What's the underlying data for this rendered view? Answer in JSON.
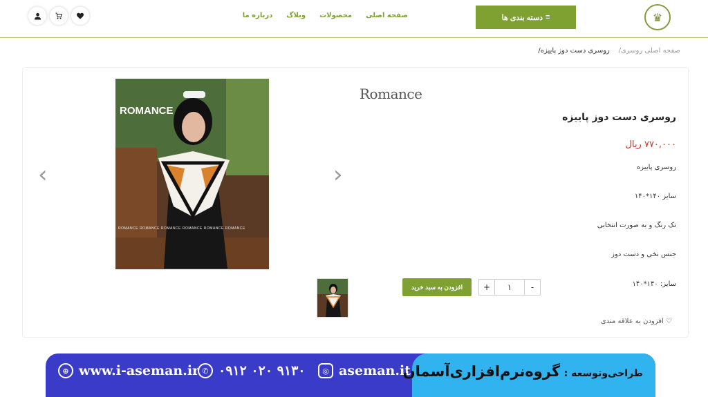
{
  "header": {
    "logo_glyph": "♛",
    "category_button": "دسته بندی ها",
    "nav": [
      "صفحه اصلی",
      "محصولات",
      "وبلاگ",
      "درباره ما"
    ],
    "icons": [
      "heart-icon",
      "cart-icon",
      "user-icon"
    ]
  },
  "breadcrumb": {
    "home": "صفحه اصلی",
    "parent": "روسری/",
    "current": "روسری دست دوز پاییزه/"
  },
  "product": {
    "brand": "Romance",
    "image_brand": "ROMANCE",
    "image_strip": "ROMANCE  ROMANCE  ROMANCE  ROMANCE  ROMANCE  ROMANCE",
    "title": "روسری دست دوز پاییزه",
    "price": "۷۷۰,۰۰۰ ریال",
    "desc1": "روسری پاییزه",
    "desc2": "سایز ۱۴۰*۱۴۰",
    "desc3": "تک رنگ و به صورت انتخابی",
    "desc4": "جنس نخی و دست دوز",
    "size_label": "سایز: ۱۴۰*۱۴۰",
    "quantity": "۱",
    "add_to_cart": "افزودن به سبد خرید",
    "wishlist": "افزودن به علاقه مندی"
  },
  "banner": {
    "website": "www.i-aseman.ir",
    "phone": "۰۹۱۲ ۰۲۰ ۹۱۳۰",
    "instagram": "aseman.it",
    "credit_prefix": "طراحی‌وتوسعه :",
    "credit_name": "گروه‌نرم‌افزاری‌آسمان"
  }
}
